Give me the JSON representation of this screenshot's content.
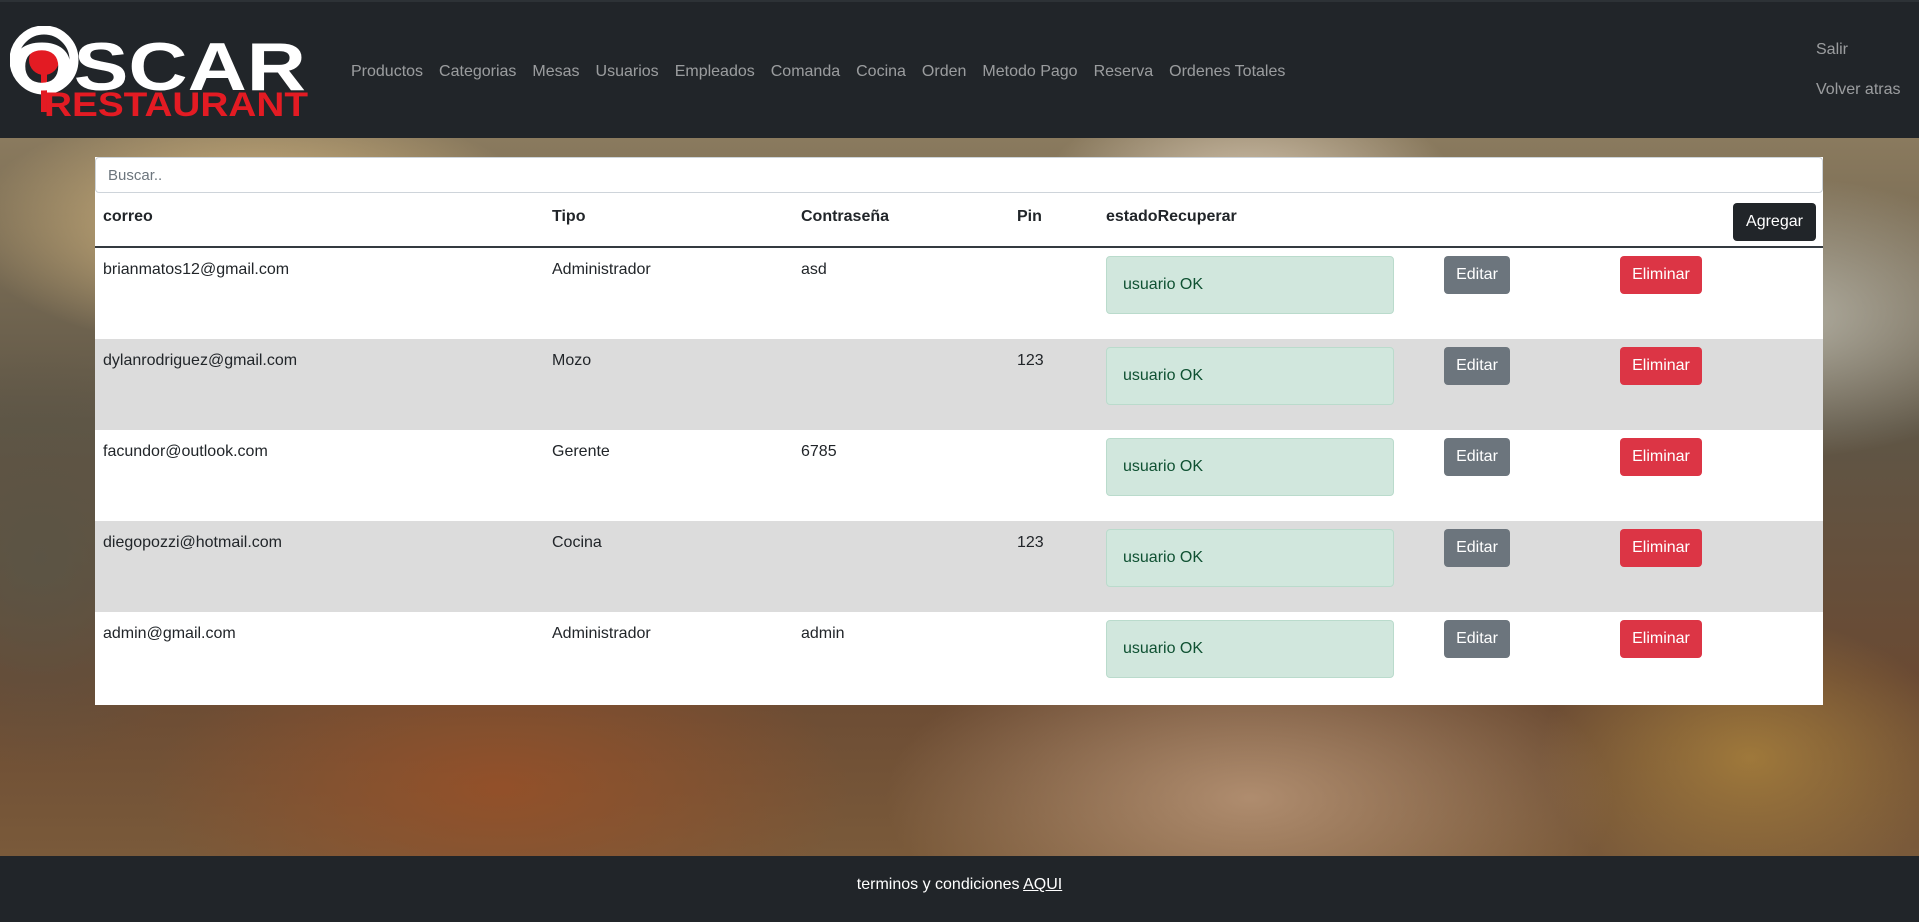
{
  "brand": {
    "name_top": "OSCAR",
    "name_bottom": "RESTAURANT"
  },
  "nav": {
    "items": [
      "Productos",
      "Categorias",
      "Mesas",
      "Usuarios",
      "Empleados",
      "Comanda",
      "Cocina",
      "Orden",
      "Metodo Pago",
      "Reserva",
      "Ordenes Totales"
    ],
    "right": [
      "Salir",
      "Volver atras"
    ]
  },
  "search": {
    "placeholder": "Buscar.."
  },
  "table": {
    "headers": [
      "correo",
      "Tipo",
      "Contraseña",
      "Pin",
      "estadoRecuperar"
    ],
    "add_label": "Agregar",
    "edit_label": "Editar",
    "delete_label": "Eliminar",
    "rows": [
      {
        "correo": "brianmatos12@gmail.com",
        "tipo": "Administrador",
        "contrasena": "asd",
        "pin": "",
        "estado": "usuario OK"
      },
      {
        "correo": "dylanrodriguez@gmail.com",
        "tipo": "Mozo",
        "contrasena": "",
        "pin": "123",
        "estado": "usuario OK"
      },
      {
        "correo": "facundor@outlook.com",
        "tipo": "Gerente",
        "contrasena": "6785",
        "pin": "",
        "estado": "usuario OK"
      },
      {
        "correo": "diegopozzi@hotmail.com",
        "tipo": "Cocina",
        "contrasena": "",
        "pin": "123",
        "estado": "usuario OK"
      },
      {
        "correo": "admin@gmail.com",
        "tipo": "Administrador",
        "contrasena": "admin",
        "pin": "",
        "estado": "usuario OK"
      }
    ]
  },
  "footer": {
    "text": "terminos y condiciones",
    "link": "AQUI"
  },
  "colors": {
    "navbar": "#212529",
    "edit_button": "#6c757d",
    "delete_button": "#dc3545",
    "status_ok_bg": "#d1e7dd",
    "status_ok_text": "#0f5132",
    "logo_red": "#e31b23"
  }
}
